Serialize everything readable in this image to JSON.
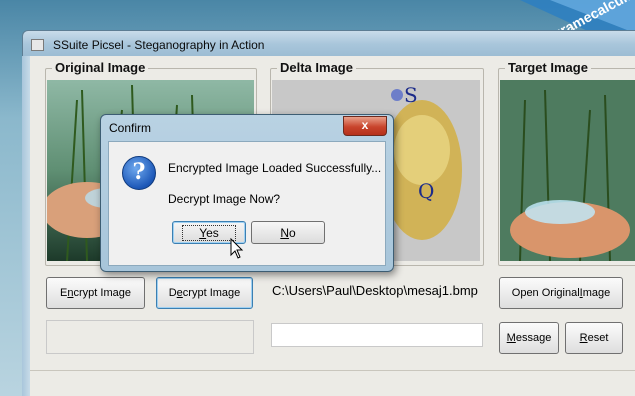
{
  "window": {
    "title": "SSuite Picsel - Steganography in Action"
  },
  "groups": {
    "original": "Original Image",
    "delta": "Delta Image",
    "target": "Target Image"
  },
  "buttons": {
    "encrypt_pre": "E",
    "encrypt_ul": "n",
    "encrypt_post": "crypt Image",
    "decrypt_pre": "D",
    "decrypt_ul": "e",
    "decrypt_post": "crypt Image",
    "open_pre": "Open Original ",
    "open_ul": "I",
    "open_post": "mage",
    "message_pre": "",
    "message_ul": "M",
    "message_post": "essage",
    "reset_pre": "",
    "reset_ul": "R",
    "reset_post": "eset"
  },
  "file_path": "C:\\Users\\Paul\\Desktop\\mesaj1.bmp",
  "dialog": {
    "title": "Confirm",
    "close_glyph": "x",
    "line1": "Encrypted Image Loaded Successfully...",
    "line2": "Decrypt Image Now?",
    "yes_ul": "Y",
    "yes_post": "es",
    "no_ul": "N",
    "no_post": "o",
    "icon_glyph": "?"
  },
  "watermark": {
    "text": "programecalculator.ro"
  },
  "colors": {
    "accent": "#3c7fb1",
    "close_red": "#c8442c",
    "titlebar": "#a9c6db"
  }
}
